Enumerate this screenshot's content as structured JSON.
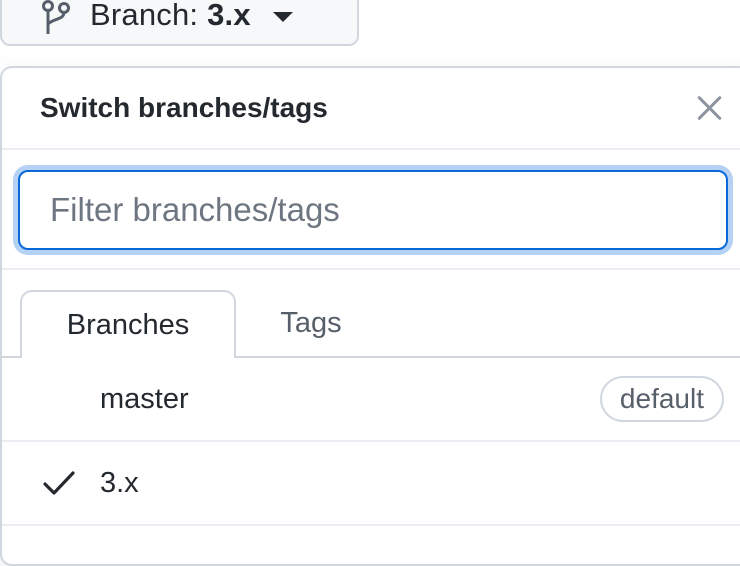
{
  "branch_button": {
    "prefix": "Branch: ",
    "current": "3.x",
    "icon": "git-branch-icon"
  },
  "panel": {
    "title": "Switch branches/tags",
    "close_icon": "close-icon"
  },
  "filter": {
    "placeholder": "Filter branches/tags",
    "value": ""
  },
  "tabs": [
    {
      "label": "Branches",
      "active": true
    },
    {
      "label": "Tags",
      "active": false
    }
  ],
  "branches": [
    {
      "name": "master",
      "badge": "default",
      "checked": false
    },
    {
      "name": "3.x",
      "badge": "",
      "checked": true
    }
  ],
  "colors": {
    "accent": "#0969da",
    "border": "#d0d7de",
    "text": "#24292f",
    "muted": "#57606a"
  }
}
